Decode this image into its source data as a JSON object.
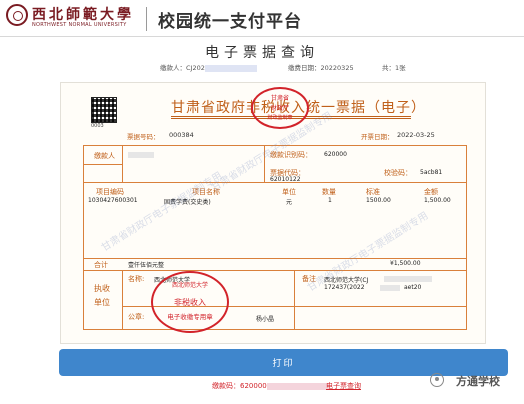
{
  "header": {
    "logo_cn": "西北師範大學",
    "logo_en": "NORTHWEST NORMAL UNIVERSITY",
    "platform_title": "校园统一支付平台"
  },
  "page": {
    "title": "电子票据查询",
    "payer_label": "缴款人：",
    "payer_value": "CJ202",
    "date_label": "缴费日期：",
    "date_value": "20220325",
    "count_label": "共：",
    "count_value": "1张"
  },
  "invoice": {
    "title": "甘肃省政府非税收入统一票据（电子）",
    "qr_label": "0003",
    "number_label": "票据号码：",
    "number_value": "000384",
    "date_label": "开票日期：",
    "date_value": "2022-03-25",
    "payer_label": "缴款人",
    "payer_code_label": "缴款识别码：",
    "payer_code_value": "620000",
    "bill_code_label": "票据代码：",
    "bill_code_value": "62010122",
    "check_code_label": "校验码：",
    "check_code_value": "5acb81",
    "columns": [
      "项目编码",
      "项目名称",
      "单位",
      "数量",
      "标准",
      "金额"
    ],
    "row": {
      "code": "1030427600301",
      "name": "固费学费(交史类)",
      "unit": "元",
      "qty": "1",
      "std": "1500.00",
      "amount": "1,500.00"
    },
    "total_label": "合计",
    "total_cn": "壹仟伍佰元整",
    "total_value": "¥1,500.00",
    "exec_label": "执收单位",
    "name_label": "名称:",
    "name_value": "西北师范大学",
    "seal_label": "公章:",
    "remark_label": "备注",
    "remark_value_1": "西北师范大学(CJ",
    "remark_value_2": "172437(2022",
    "remark_value_3": "aet20",
    "handler": "杨小晶"
  },
  "stamps": {
    "top": {
      "line1": "甘肃省",
      "line2": "财政厅",
      "line3": "财政监制章"
    },
    "bottom": {
      "top_text": "西北师范大学",
      "line1": "非税收入",
      "line2": "电子收缴专用章"
    }
  },
  "watermark": "甘肃省财政厅电子票据监制专用",
  "actions": {
    "print_label": "打印"
  },
  "footer": {
    "code_label": "缴款码：",
    "code_value": "620000",
    "link_label": "电子票查询"
  },
  "brand": {
    "wechat_account": "方通学校"
  },
  "colors": {
    "accent_orange": "#c0601a",
    "stamp_red": "#d2232a",
    "button_blue": "#3f86cc",
    "logo_maroon": "#7a1b22"
  }
}
